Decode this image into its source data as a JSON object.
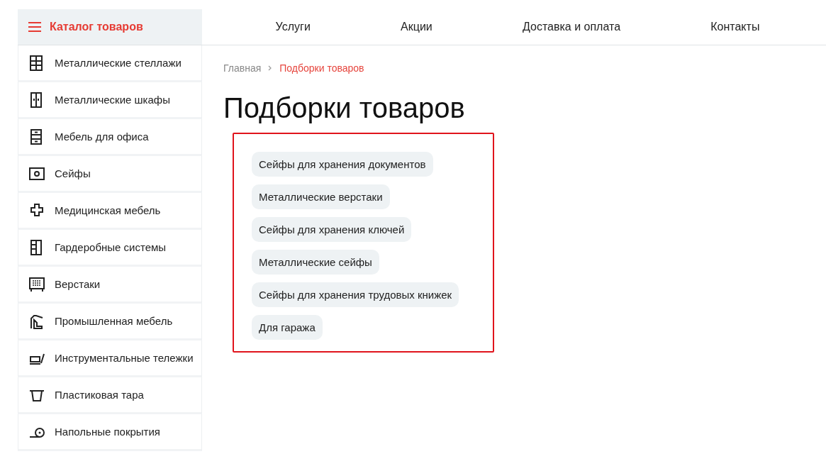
{
  "catalog_button": {
    "label": "Каталог товаров"
  },
  "nav": [
    "Услуги",
    "Акции",
    "Доставка и оплата",
    "Контакты"
  ],
  "sidebar": {
    "items": [
      {
        "label": "Металлические стеллажи"
      },
      {
        "label": "Металлические шкафы"
      },
      {
        "label": "Мебель для офиса"
      },
      {
        "label": "Сейфы"
      },
      {
        "label": "Медицинская мебель"
      },
      {
        "label": "Гардеробные системы"
      },
      {
        "label": "Верстаки"
      },
      {
        "label": "Промышленная мебель"
      },
      {
        "label": "Инструментальные тележки"
      },
      {
        "label": "Пластиковая тара"
      },
      {
        "label": "Напольные покрытия"
      }
    ]
  },
  "breadcrumbs": [
    {
      "label": "Главная",
      "selected": false
    },
    {
      "label": "Подборки товаров",
      "selected": true
    }
  ],
  "title": "Подборки товаров",
  "tags": [
    "Сейфы для хранения документов",
    "Металлические верстаки",
    "Сейфы для хранения ключей",
    "Металлические сейфы",
    "Сейфы для хранения трудовых книжек",
    "Для гаража"
  ]
}
